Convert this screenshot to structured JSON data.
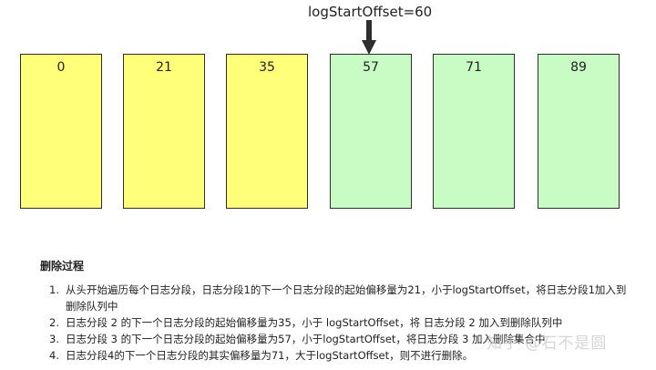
{
  "marker": {
    "label": "logStartOffset=60"
  },
  "segments": [
    {
      "base_offset": "0",
      "status": "deleted"
    },
    {
      "base_offset": "21",
      "status": "deleted"
    },
    {
      "base_offset": "35",
      "status": "deleted"
    },
    {
      "base_offset": "57",
      "status": "kept"
    },
    {
      "base_offset": "71",
      "status": "kept"
    },
    {
      "base_offset": "89",
      "status": "kept"
    }
  ],
  "colors": {
    "deleted": "#ffff7a",
    "kept": "#c9fbc4",
    "border": "#2e2e2e"
  },
  "process": {
    "title": "删除过程",
    "steps": [
      {
        "num": "1.",
        "text": "从头开始遍历每个日志分段，日志分段1的下一个日志分段的起始偏移量为21，小于logStartOffset，将日志分段1加入到删除队列中"
      },
      {
        "num": "2.",
        "text": "日志分段 2 的下一个日志分段的起始偏移量为35，小于 logStartOffset，将 日志分段 2 加入到删除队列中"
      },
      {
        "num": "3.",
        "text": "日志分段 3 的下一个日志分段的起始偏移量为57，小于logStartOffset，将日志分段 3 加入删除集合中"
      },
      {
        "num": "4.",
        "text": "日志分段4的下一个日志分段的其实偏移量为71，大于logStartOffset，则不进行删除。"
      }
    ]
  },
  "watermark": "知乎 @石不是圆"
}
